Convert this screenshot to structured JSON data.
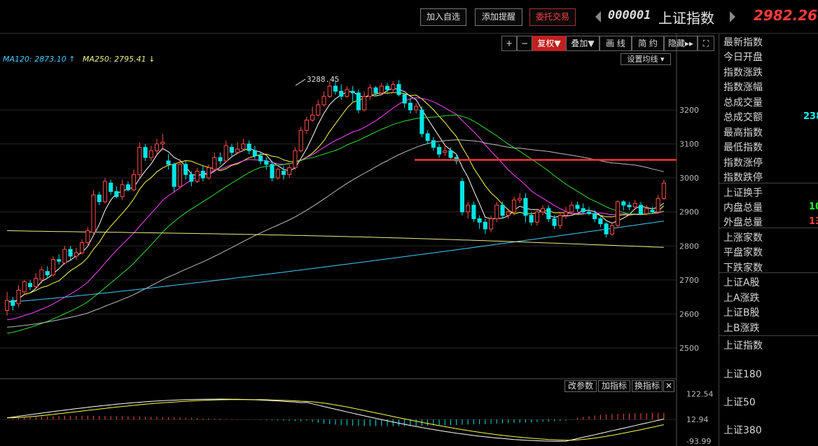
{
  "header": {
    "buttons": [
      "加入自选",
      "添加提醒",
      "委托交易"
    ],
    "code": "000001",
    "name": "上证指数",
    "price": "2982.26"
  },
  "toolbar": {
    "plus": "+",
    "minus": "−",
    "fuquan": "复权",
    "overlay": "叠加",
    "draw": "画 线",
    "simple": "简 约",
    "hide": "隐藏",
    "expand": "⛶"
  },
  "ma_legend": {
    "ma120": "MA120: 2873.10",
    "ma120_arrow": "↑",
    "ma250": "MA250: 2795.41",
    "ma250_arrow": "↓"
  },
  "set_ma_button": "设置均线",
  "indicator_buttons": [
    "改参数",
    "加指标",
    "换指标"
  ],
  "close_symbol": "✕",
  "right_panel": {
    "items": [
      "最新指数",
      "今日开盘",
      "指数涨跌",
      "指数涨幅",
      "总成交量",
      "总成交额",
      "最高指数",
      "最低指数",
      "指数涨停",
      "指数跌停",
      "上证换手",
      "内盘总量",
      "外盘总量",
      "上涨家数",
      "平盘家数",
      "下跌家数",
      "上证A股",
      "上A涨跌",
      "上证B股",
      "上B涨跌",
      "上证指数",
      "上证180",
      "上证50",
      "上证380"
    ],
    "value_turnover": "238",
    "value_inner": "10",
    "value_outer": "13"
  },
  "colors": {
    "up": "#ff4d4d",
    "down": "#00e5e5",
    "ma5": "#ffffff",
    "ma10": "#ffff44",
    "ma20": "#ff44ff",
    "ma30": "#33dd33",
    "ma60": "#bbbbbb",
    "ma120": "#44ccff",
    "ma250": "#eeee88",
    "hline": "#ff3030"
  },
  "chart_data": {
    "type": "candlestick",
    "y_ticks": [
      3200,
      3100,
      3000,
      2900,
      2800,
      2700,
      2600,
      2500
    ],
    "ylim": [
      2410,
      3330
    ],
    "annotation": "3288.45",
    "annotation_value": 3288.45,
    "hline_value": 3053,
    "ma120_last": 2873.1,
    "ma250_last": 2795.41,
    "candles": [
      [
        2610,
        2640,
        2665,
        2595
      ],
      [
        2640,
        2625,
        2650,
        2610
      ],
      [
        2630,
        2670,
        2685,
        2620
      ],
      [
        2665,
        2695,
        2700,
        2655
      ],
      [
        2690,
        2680,
        2700,
        2670
      ],
      [
        2680,
        2705,
        2720,
        2675
      ],
      [
        2700,
        2730,
        2740,
        2690
      ],
      [
        2725,
        2715,
        2740,
        2705
      ],
      [
        2715,
        2760,
        2770,
        2710
      ],
      [
        2760,
        2755,
        2775,
        2745
      ],
      [
        2750,
        2790,
        2800,
        2745
      ],
      [
        2790,
        2770,
        2800,
        2760
      ],
      [
        2770,
        2780,
        2795,
        2760
      ],
      [
        2780,
        2810,
        2820,
        2775
      ],
      [
        2810,
        2845,
        2855,
        2800
      ],
      [
        2840,
        2950,
        2965,
        2835
      ],
      [
        2950,
        2930,
        2960,
        2920
      ],
      [
        2930,
        2990,
        3000,
        2925
      ],
      [
        2985,
        2960,
        2995,
        2950
      ],
      [
        2960,
        2945,
        2975,
        2940
      ],
      [
        2945,
        2980,
        2995,
        2935
      ],
      [
        2980,
        2965,
        2990,
        2960
      ],
      [
        2965,
        3010,
        3025,
        2960
      ],
      [
        3010,
        3090,
        3105,
        3000
      ],
      [
        3090,
        3060,
        3100,
        3050
      ],
      [
        3060,
        3080,
        3095,
        3050
      ],
      [
        3080,
        3100,
        3115,
        3070
      ],
      [
        3100,
        3105,
        3130,
        3080
      ],
      [
        3050,
        3040,
        3070,
        3025
      ],
      [
        3040,
        2975,
        3045,
        2960
      ],
      [
        2975,
        3040,
        3055,
        2970
      ],
      [
        3040,
        3010,
        3050,
        2995
      ],
      [
        3010,
        2990,
        3020,
        2975
      ],
      [
        2990,
        3020,
        3030,
        2985
      ],
      [
        3020,
        3000,
        3035,
        2990
      ],
      [
        3000,
        3030,
        3040,
        2995
      ],
      [
        3025,
        3060,
        3075,
        3020
      ],
      [
        3060,
        3050,
        3075,
        3040
      ],
      [
        3050,
        3095,
        3110,
        3045
      ],
      [
        3090,
        3075,
        3100,
        3060
      ],
      [
        3075,
        3085,
        3105,
        3070
      ],
      [
        3085,
        3100,
        3115,
        3080
      ],
      [
        3100,
        3080,
        3110,
        3070
      ],
      [
        3080,
        3065,
        3095,
        3055
      ],
      [
        3065,
        3050,
        3075,
        3040
      ],
      [
        3050,
        3040,
        3060,
        3025
      ],
      [
        3040,
        3000,
        3050,
        2990
      ],
      [
        3000,
        3025,
        3030,
        2995
      ],
      [
        3020,
        3010,
        3035,
        2995
      ],
      [
        3010,
        3030,
        3040,
        3000
      ],
      [
        3030,
        3080,
        3090,
        3025
      ],
      [
        3080,
        3140,
        3150,
        3075
      ],
      [
        3140,
        3170,
        3180,
        3130
      ],
      [
        3170,
        3185,
        3210,
        3165
      ],
      [
        3185,
        3215,
        3230,
        3180
      ],
      [
        3215,
        3240,
        3255,
        3210
      ],
      [
        3240,
        3270,
        3285,
        3235
      ],
      [
        3270,
        3255,
        3288,
        3245
      ],
      [
        3255,
        3240,
        3275,
        3230
      ],
      [
        3240,
        3260,
        3270,
        3235
      ],
      [
        3255,
        3250,
        3270,
        3225
      ],
      [
        3250,
        3200,
        3260,
        3190
      ],
      [
        3200,
        3240,
        3255,
        3195
      ],
      [
        3240,
        3265,
        3275,
        3230
      ],
      [
        3265,
        3250,
        3270,
        3240
      ],
      [
        3250,
        3270,
        3280,
        3245
      ],
      [
        3270,
        3260,
        3280,
        3250
      ],
      [
        3260,
        3275,
        3285,
        3250
      ],
      [
        3275,
        3245,
        3288,
        3240
      ],
      [
        3245,
        3220,
        3250,
        3205
      ],
      [
        3220,
        3200,
        3235,
        3190
      ],
      [
        3200,
        3210,
        3220,
        3190
      ],
      [
        3200,
        3130,
        3210,
        3120
      ],
      [
        3130,
        3110,
        3140,
        3100
      ],
      [
        3110,
        3090,
        3120,
        3080
      ],
      [
        3090,
        3070,
        3100,
        3060
      ],
      [
        3075,
        3080,
        3100,
        3065
      ],
      [
        3080,
        3060,
        3090,
        3050
      ],
      [
        3060,
        3050,
        3070,
        3040
      ],
      [
        2990,
        2900,
        3000,
        2890
      ],
      [
        2900,
        2920,
        2930,
        2880
      ],
      [
        2920,
        2880,
        2930,
        2870
      ],
      [
        2880,
        2870,
        2890,
        2850
      ],
      [
        2870,
        2850,
        2880,
        2835
      ],
      [
        2850,
        2880,
        2890,
        2840
      ],
      [
        2880,
        2920,
        2930,
        2870
      ],
      [
        2920,
        2890,
        2930,
        2880
      ],
      [
        2890,
        2900,
        2910,
        2880
      ],
      [
        2900,
        2935,
        2945,
        2890
      ],
      [
        2935,
        2940,
        2955,
        2925
      ],
      [
        2940,
        2890,
        2955,
        2870
      ],
      [
        2890,
        2870,
        2900,
        2860
      ],
      [
        2870,
        2900,
        2910,
        2860
      ],
      [
        2900,
        2910,
        2920,
        2890
      ],
      [
        2910,
        2880,
        2920,
        2870
      ],
      [
        2880,
        2860,
        2890,
        2850
      ],
      [
        2860,
        2890,
        2900,
        2850
      ],
      [
        2890,
        2900,
        2915,
        2880
      ],
      [
        2900,
        2920,
        2930,
        2890
      ],
      [
        2920,
        2910,
        2930,
        2900
      ],
      [
        2910,
        2900,
        2925,
        2895
      ],
      [
        2900,
        2895,
        2915,
        2890
      ],
      [
        2895,
        2880,
        2905,
        2870
      ],
      [
        2880,
        2865,
        2890,
        2855
      ],
      [
        2865,
        2835,
        2870,
        2825
      ],
      [
        2835,
        2860,
        2870,
        2830
      ],
      [
        2860,
        2930,
        2935,
        2855
      ],
      [
        2930,
        2920,
        2935,
        2905
      ],
      [
        2920,
        2915,
        2930,
        2905
      ],
      [
        2915,
        2925,
        2935,
        2905
      ],
      [
        2920,
        2895,
        2930,
        2890
      ],
      [
        2895,
        2910,
        2920,
        2890
      ],
      [
        2905,
        2900,
        2915,
        2895
      ],
      [
        2900,
        2940,
        2950,
        2895
      ],
      [
        2940,
        2985,
        2995,
        2935
      ]
    ],
    "indicator": {
      "y_ticks": [
        "122.54",
        "12.94",
        "-93.99"
      ],
      "ylim": [
        -100,
        130
      ]
    }
  }
}
